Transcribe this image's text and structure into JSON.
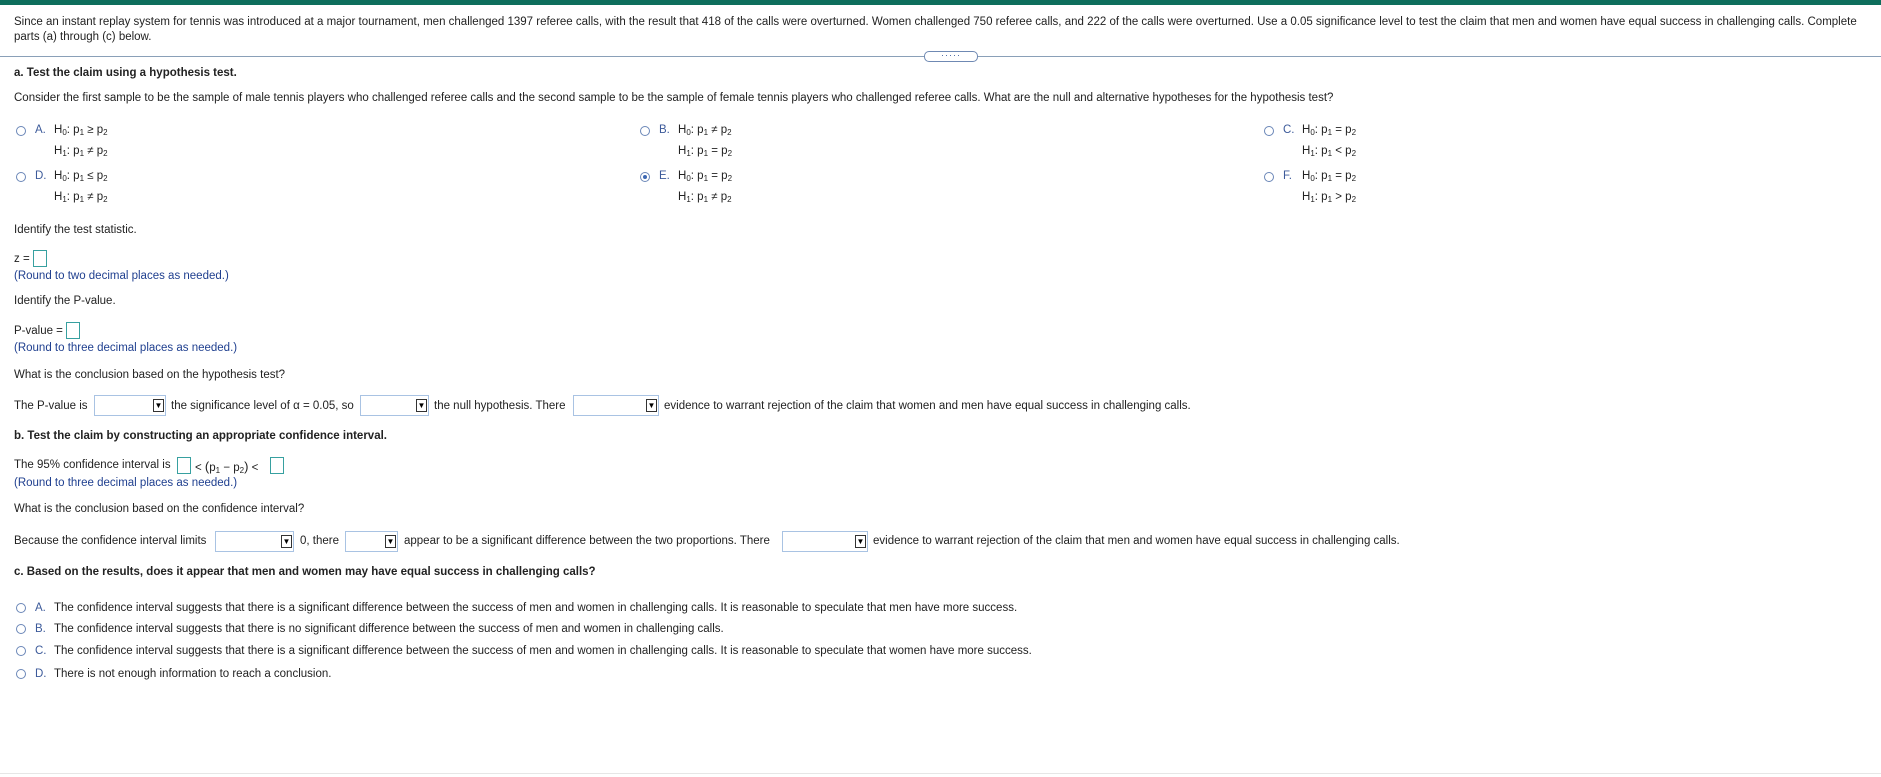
{
  "problem_text": "Since an instant replay system for tennis was introduced at a major tournament, men challenged 1397 referee calls, with the result that 418 of the calls were overturned. Women challenged 750 referee calls, and 222 of the calls were overturned. Use a 0.05 significance level to test the claim that men and women have equal success in challenging calls. Complete parts (a) through (c) below.",
  "expander_label": "·····",
  "part_a": {
    "heading": "a. Test the claim using a hypothesis test.",
    "question": "Consider the first sample to be the sample of male tennis players who challenged referee calls and the second sample to be the sample of female tennis players who challenged referee calls. What are the null and alternative hypotheses for the hypothesis test?",
    "options": [
      {
        "letter": "A.",
        "h0": "≥",
        "h1": "≠",
        "selected": false
      },
      {
        "letter": "B.",
        "h0": "≠",
        "h1": "=",
        "selected": false
      },
      {
        "letter": "C.",
        "h0": "=",
        "h1": "<",
        "selected": false
      },
      {
        "letter": "D.",
        "h0": "≤",
        "h1": "≠",
        "selected": false
      },
      {
        "letter": "E.",
        "h0": "=",
        "h1": "≠",
        "selected": true
      },
      {
        "letter": "F.",
        "h0": "=",
        "h1": ">",
        "selected": false
      }
    ],
    "test_stat_prompt": "Identify the test statistic.",
    "z_label": "z =",
    "z_hint": "(Round to two decimal places as needed.)",
    "pvalue_prompt": "Identify the P-value.",
    "pvalue_label": "P-value =",
    "pvalue_hint": "(Round to three decimal places as needed.)",
    "conclusion_prompt": "What is the conclusion based on the hypothesis test?",
    "sentence": {
      "part1": "The P-value is",
      "part2": "the significance level of α = 0.05, so",
      "part3": "the null hypothesis. There",
      "part4": "evidence to warrant rejection of the claim that women and men have equal success in challenging calls."
    }
  },
  "part_b": {
    "heading": "b. Test the claim by constructing an appropriate confidence interval.",
    "ci_label": "The 95% confidence interval is",
    "ci_lt": "<",
    "ci_p1": "p",
    "ci_minus": "−",
    "ci_p2": "p",
    "ci_lt2": "<",
    "ci_hint": "(Round to three decimal places as needed.)",
    "conclusion_prompt": "What is the conclusion based on the confidence interval?",
    "sentence": {
      "part1": "Because the confidence interval limits",
      "part2": "0, there",
      "part3": "appear to be a significant difference between the two proportions. There",
      "part4": "evidence to warrant rejection of the claim that men and women have equal success in challenging calls."
    }
  },
  "part_c": {
    "heading": "c. Based on the results, does it appear that men and women may have equal success in challenging calls?",
    "options": [
      {
        "letter": "A.",
        "text": "The confidence interval suggests that there is a significant difference between the success of men and women in challenging calls. It is reasonable to speculate that men have more success."
      },
      {
        "letter": "B.",
        "text": "The confidence interval suggests that there is no significant difference between the success of men and women in challenging calls."
      },
      {
        "letter": "C.",
        "text": "The confidence interval suggests that there is a significant difference between the success of men and women in challenging calls. It is reasonable to speculate that women have more success."
      },
      {
        "letter": "D.",
        "text": "There is not enough information to reach a conclusion."
      }
    ]
  },
  "symbols": {
    "H": "H",
    "zero": "0",
    "one": "1",
    "two": "2",
    "colon": ":",
    "p": "p",
    "dd_arrow": "▼"
  }
}
